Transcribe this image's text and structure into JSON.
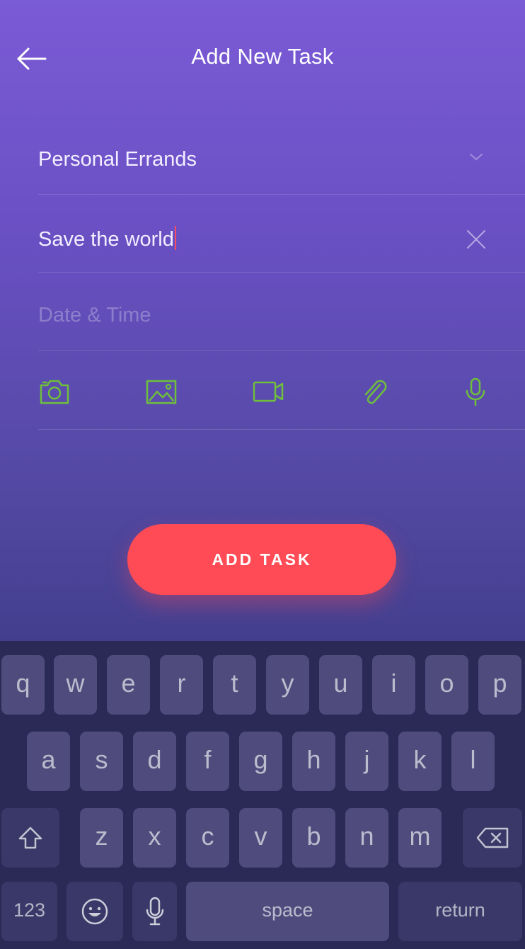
{
  "header": {
    "title": "Add New Task",
    "back_icon": "arrow-left-icon"
  },
  "form": {
    "category": {
      "value": "Personal Errands",
      "icon": "chevron-down-icon"
    },
    "task_name": {
      "value": "Save the world",
      "clear_icon": "close-icon"
    },
    "date_time": {
      "placeholder": "Date & Time"
    },
    "attachments": [
      "camera-icon",
      "image-icon",
      "video-icon",
      "paperclip-icon",
      "microphone-icon"
    ]
  },
  "add_button": {
    "label": "ADD TASK"
  },
  "keyboard": {
    "row1": [
      "q",
      "w",
      "e",
      "r",
      "t",
      "y",
      "u",
      "i",
      "o",
      "p"
    ],
    "row2": [
      "a",
      "s",
      "d",
      "f",
      "g",
      "h",
      "j",
      "k",
      "l"
    ],
    "row3": [
      "z",
      "x",
      "c",
      "v",
      "b",
      "n",
      "m"
    ],
    "numbers_label": "123",
    "space_label": "space",
    "return_label": "return"
  },
  "colors": {
    "gradient_top": "#7b5bd6",
    "gradient_bottom": "#433f8e",
    "accent_green": "#6ebf3b",
    "button_red": "#ff4b55",
    "keyboard_bg": "#2b2a56",
    "key_bg": "#4f4c7d"
  }
}
